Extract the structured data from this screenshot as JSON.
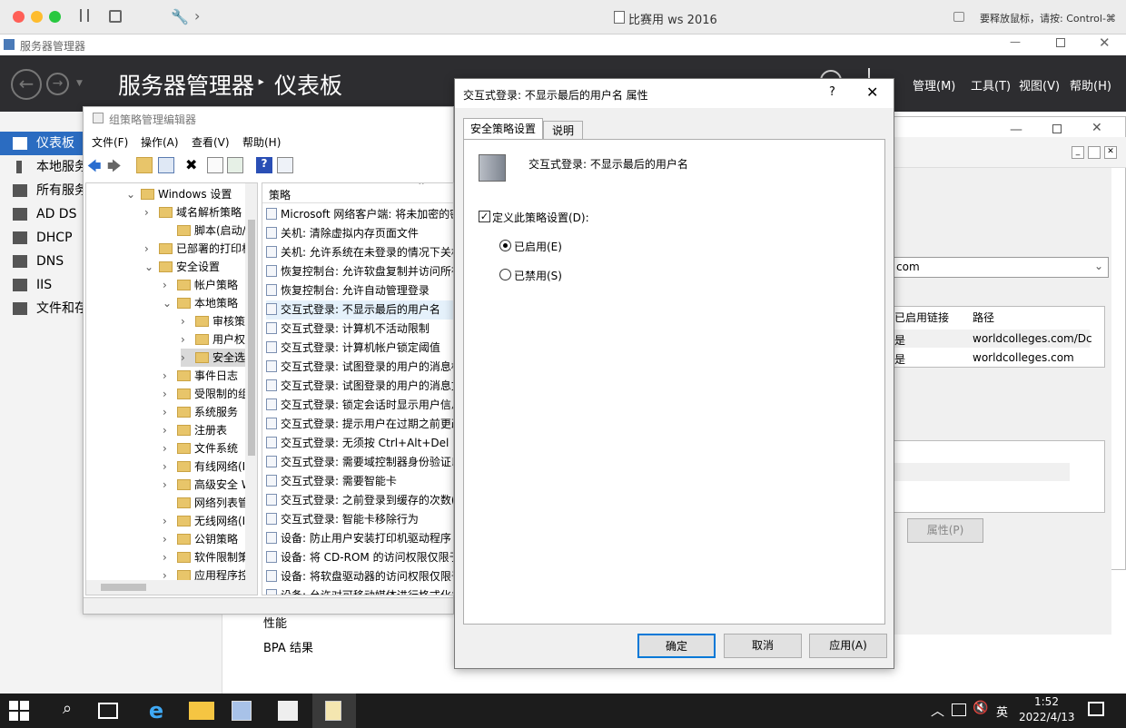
{
  "mac": {
    "title": "比赛用 ws 2016",
    "hint": "要释放鼠标，请按: Control-⌘"
  },
  "srv": {
    "window_title": "服务器管理器",
    "header_title": "服务器管理器",
    "header_arrow": "‣",
    "header_page": "仪表板",
    "menu": [
      "管理(M)",
      "工具(T)",
      "视图(V)",
      "帮助(H)"
    ],
    "nav": [
      "仪表板",
      "本地服务",
      "所有服务",
      "AD DS",
      "DHCP",
      "DNS",
      "IIS",
      "文件和存"
    ],
    "bottom_items": [
      "性能",
      "BPA 结果"
    ]
  },
  "gpe": {
    "title": "组策略管理编辑器",
    "menu": [
      "文件(F)",
      "操作(A)",
      "查看(V)",
      "帮助(H)"
    ],
    "tree": [
      "Windows 设置",
      "域名解析策略",
      "脚本(启动/关机)",
      "已部署的打印机",
      "安全设置",
      "帐户策略",
      "本地策略",
      "审核策",
      "用户权",
      "安全选",
      "事件日志",
      "受限制的组",
      "系统服务",
      "注册表",
      "文件系统",
      "有线网络(IE",
      "高级安全 W",
      "网络列表管",
      "无线网络(IE",
      "公钥策略",
      "软件限制策",
      "应用程序控"
    ],
    "col_header": "策略",
    "policies": [
      "Microsoft 网络客户端: 将未加密的密",
      "关机: 清除虚拟内存页面文件",
      "关机: 允许系统在未登录的情况下关机",
      "恢复控制台: 允许软盘复制并访问所有",
      "恢复控制台: 允许自动管理登录",
      "交互式登录: 不显示最后的用户名",
      "交互式登录: 计算机不活动限制",
      "交互式登录: 计算机帐户锁定阈值",
      "交互式登录: 试图登录的用户的消息标",
      "交互式登录: 试图登录的用户的消息文",
      "交互式登录: 锁定会话时显示用户信息",
      "交互式登录: 提示用户在过期之前更改",
      "交互式登录: 无须按 Ctrl+Alt+Del",
      "交互式登录: 需要域控制器身份验证以",
      "交互式登录: 需要智能卡",
      "交互式登录: 之前登录到缓存的次数(",
      "交互式登录: 智能卡移除行为",
      "设备: 防止用户安装打印机驱动程序",
      "设备: 将 CD-ROM 的访问权限仅限于",
      "设备: 将软盘驱动器的访问权限仅限于",
      "设备: 允许对可移动媒体进行格式化并"
    ]
  },
  "rwin": {
    "combo": "com",
    "col1": "已启用链接",
    "col2": "路径",
    "rows": [
      [
        "是",
        "worldcolleges.com/Dc"
      ],
      [
        "是",
        "worldcolleges.com"
      ]
    ],
    "props_btn": "属性(P)"
  },
  "dlg": {
    "title": "交互式登录: 不显示最后的用户名 属性",
    "help": "?",
    "tabs": [
      "安全策略设置",
      "说明"
    ],
    "policy_name": "交互式登录: 不显示最后的用户名",
    "define_label": "定义此策略设置(D):",
    "enabled": "已启用(E)",
    "disabled": "已禁用(S)",
    "ok": "确定",
    "cancel": "取消",
    "apply": "应用(A)"
  },
  "taskbar": {
    "ime": "英",
    "time": "1:52",
    "date": "2022/4/13"
  }
}
